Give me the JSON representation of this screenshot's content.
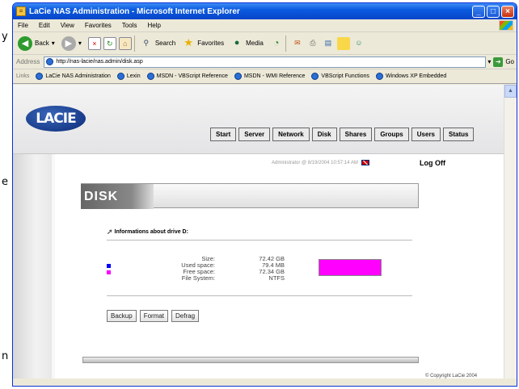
{
  "background_text": [
    "y",
    "e",
    "n"
  ],
  "window": {
    "title": "LaCie NAS Administration - Microsoft Internet Explorer",
    "menu": [
      "File",
      "Edit",
      "View",
      "Favorites",
      "Tools",
      "Help"
    ],
    "toolbar": {
      "back": "Back",
      "search": "Search",
      "favorites": "Favorites",
      "media": "Media"
    },
    "address_label": "Address",
    "address": "http://nas-lacie/nas.admin/disk.asp",
    "go": "Go",
    "links_label": "Links",
    "links": [
      "LaCie NAS Administration",
      "Lexin",
      "MSDN - VBScript Reference",
      "MSDN - WMI Reference",
      "VBScript Functions",
      "Windows XP Embedded"
    ]
  },
  "page": {
    "logo": "LACIE",
    "tabs": [
      "Start",
      "Server",
      "Network",
      "Disk",
      "Shares",
      "Groups",
      "Users",
      "Status"
    ],
    "user_info": "Administrator @ 8/19/2004 10:57:14 AM",
    "logoff": "Log Off",
    "section_title": "DISK",
    "drive_heading": "Informations about drive D:",
    "size_label": "Size:",
    "size_value": "72.42 GB",
    "used_label": "Used space:",
    "used_value": "79.4 MB",
    "free_label": "Free space:",
    "free_value": "72.34 GB",
    "fs_label": "File System:",
    "fs_value": "NTFS",
    "used_fraction": 0.001,
    "buttons": {
      "backup": "Backup",
      "format": "Format",
      "defrag": "Defrag"
    },
    "copyright": "© Copyright LaCie 2004"
  },
  "colors": {
    "used": "#0000ff",
    "free": "#ff00ff"
  }
}
